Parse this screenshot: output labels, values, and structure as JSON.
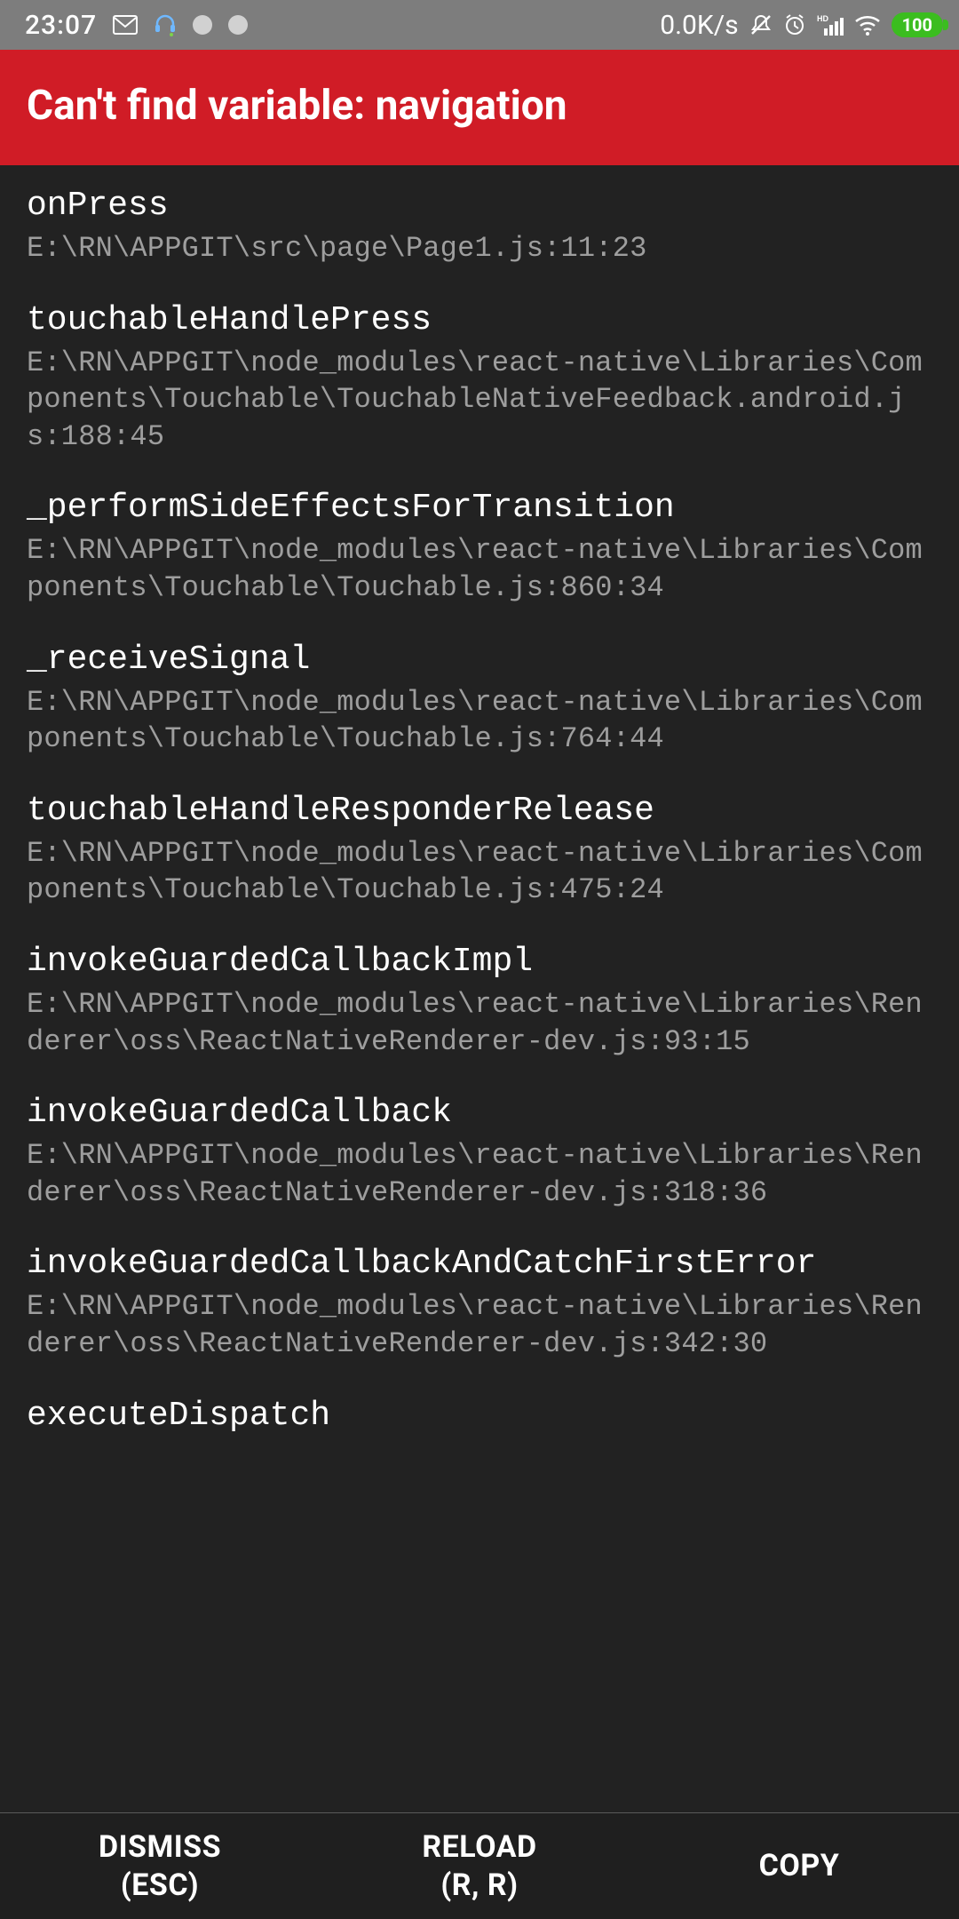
{
  "statusbar": {
    "time": "23:07",
    "net_speed": "0.0K/s",
    "battery": "100"
  },
  "error": {
    "title": "Can't find variable: navigation"
  },
  "stack": [
    {
      "fn": "onPress",
      "path": "E:\\RN\\APPGIT\\src\\page\\Page1.js:11:23"
    },
    {
      "fn": "touchableHandlePress",
      "path": "E:\\RN\\APPGIT\\node_modules\\react-native\\Libraries\\Components\\Touchable\\TouchableNativeFeedback.android.js:188:45"
    },
    {
      "fn": "_performSideEffectsForTransition",
      "path": "E:\\RN\\APPGIT\\node_modules\\react-native\\Libraries\\Components\\Touchable\\Touchable.js:860:34"
    },
    {
      "fn": "_receiveSignal",
      "path": "E:\\RN\\APPGIT\\node_modules\\react-native\\Libraries\\Components\\Touchable\\Touchable.js:764:44"
    },
    {
      "fn": "touchableHandleResponderRelease",
      "path": "E:\\RN\\APPGIT\\node_modules\\react-native\\Libraries\\Components\\Touchable\\Touchable.js:475:24"
    },
    {
      "fn": "invokeGuardedCallbackImpl",
      "path": "E:\\RN\\APPGIT\\node_modules\\react-native\\Libraries\\Renderer\\oss\\ReactNativeRenderer-dev.js:93:15"
    },
    {
      "fn": "invokeGuardedCallback",
      "path": "E:\\RN\\APPGIT\\node_modules\\react-native\\Libraries\\Renderer\\oss\\ReactNativeRenderer-dev.js:318:36"
    },
    {
      "fn": "invokeGuardedCallbackAndCatchFirstError",
      "path": "E:\\RN\\APPGIT\\node_modules\\react-native\\Libraries\\Renderer\\oss\\ReactNativeRenderer-dev.js:342:30"
    },
    {
      "fn": "executeDispatch",
      "path": ""
    }
  ],
  "footer": {
    "dismiss_line1": "DISMISS",
    "dismiss_line2": "(ESC)",
    "reload_line1": "RELOAD",
    "reload_line2": "(R, R)",
    "copy": "COPY"
  }
}
